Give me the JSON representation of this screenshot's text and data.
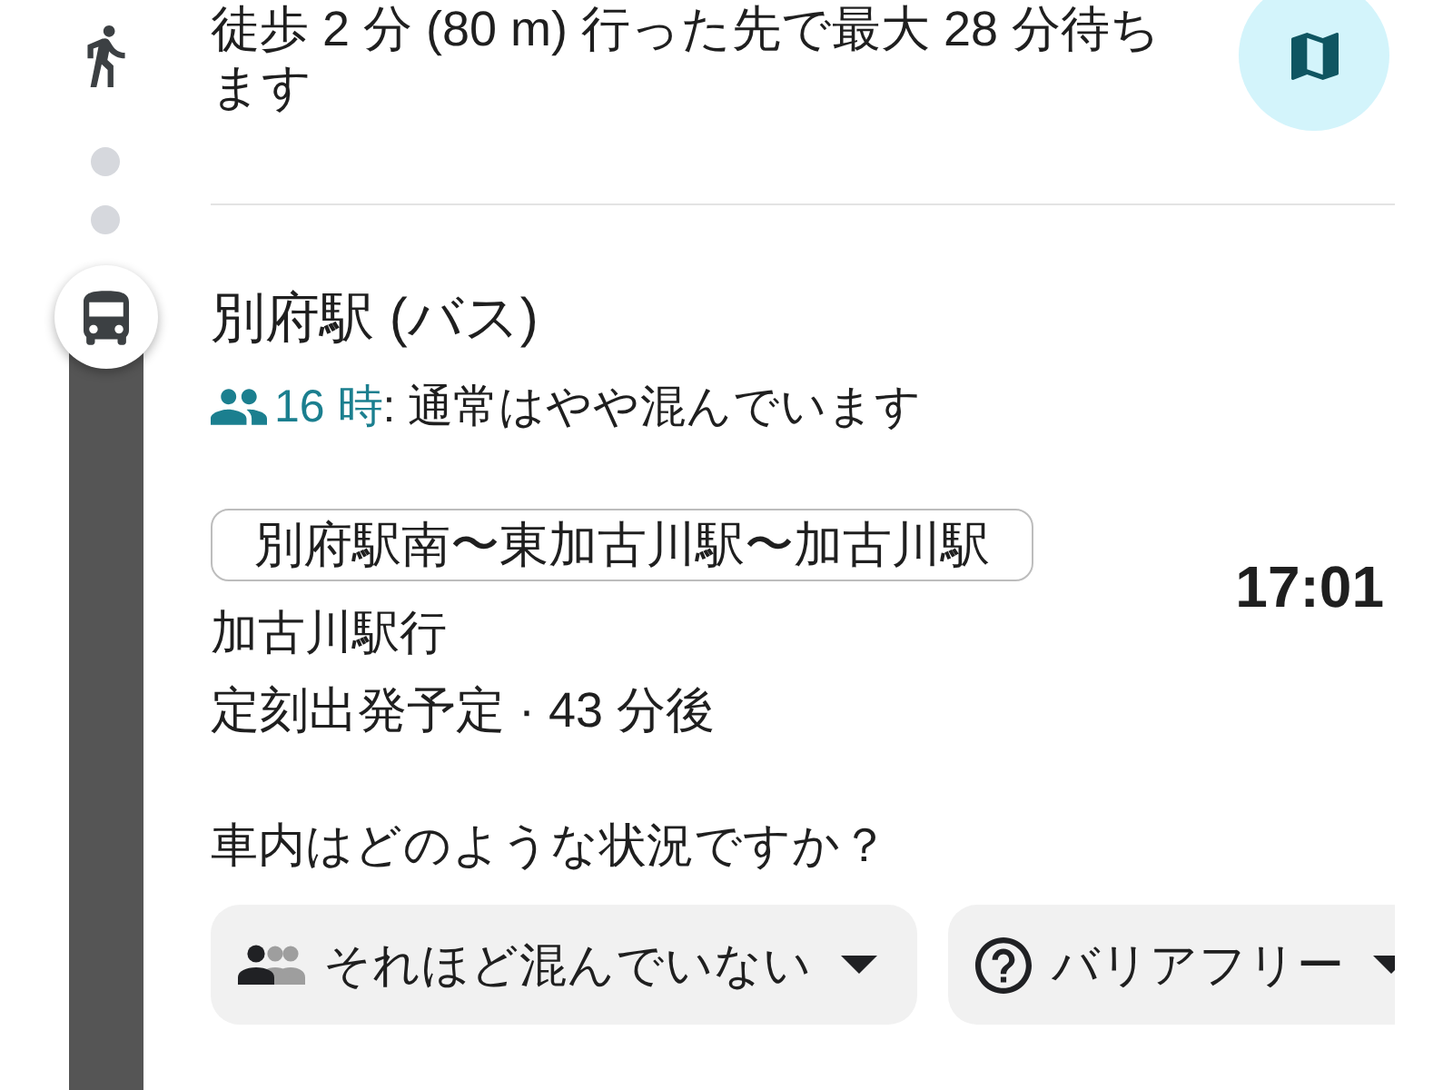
{
  "walk_step": {
    "text": "徒歩 2 分 (80 m) 行った先で最大 28 分待ちます"
  },
  "transit_step": {
    "stop_name": "別府駅 (バス)",
    "crowd_forecast": {
      "hour": "16 時",
      "text": ": 通常はやや混んでいます"
    },
    "route": "別府駅南〜東加古川駅〜加古川駅",
    "destination": "加古川駅行",
    "departure_status": "定刻出発予定 · 43 分後",
    "departure_time": "17:01"
  },
  "feedback": {
    "question": "車内はどのような状況ですか？",
    "chips": [
      {
        "kind": "crowding",
        "label": "それほど混んでいない"
      },
      {
        "kind": "accessibility",
        "label": "バリアフリー"
      }
    ]
  }
}
